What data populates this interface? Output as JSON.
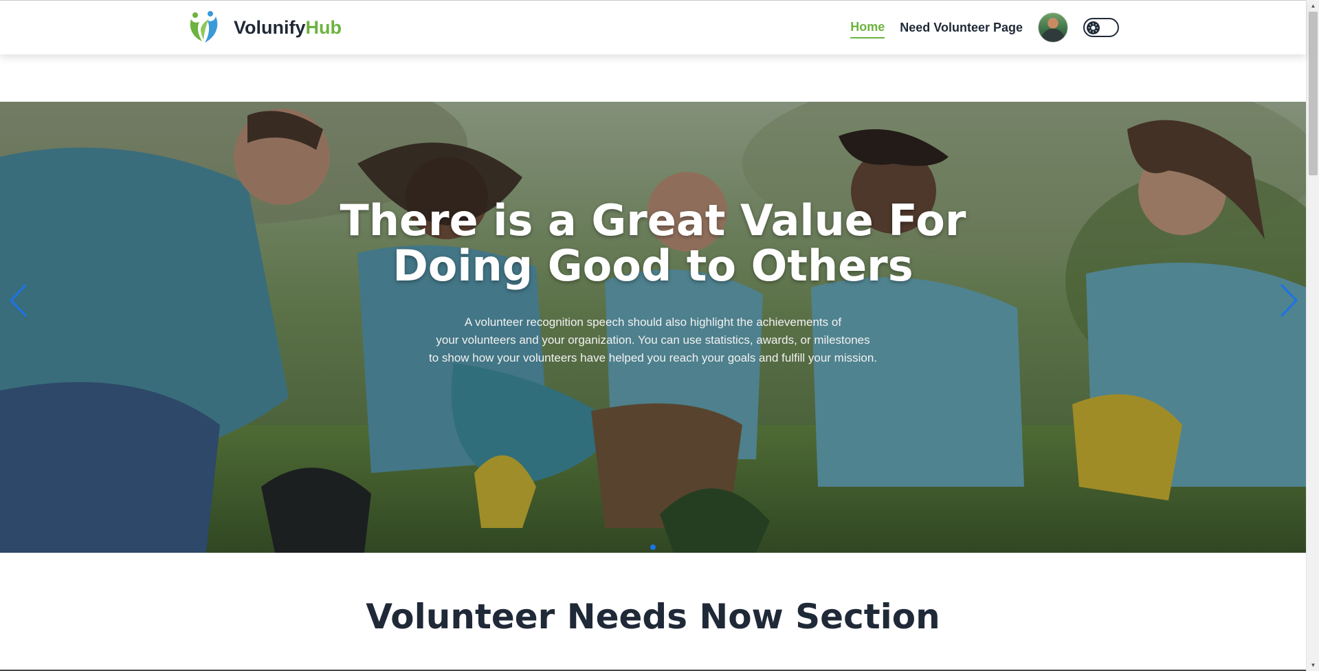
{
  "brand": {
    "name_main": "Volunify",
    "name_accent": "Hub",
    "logo_icon": "leaf-people-logo-icon",
    "accent_color": "#6cb33f"
  },
  "nav": {
    "items": [
      {
        "label": "Home",
        "active": true
      },
      {
        "label": "Need Volunteer Page",
        "active": false
      }
    ],
    "avatar_icon": "user-avatar",
    "theme_toggle_icon": "sun-icon"
  },
  "hero": {
    "title": "There is a Great Value For Doing Good to Others",
    "description_lines": [
      "A volunteer recognition speech should also highlight the achievements of",
      "your volunteers and your organization. You can use statistics, awards, or milestones",
      "to show how your volunteers have helped you reach your goals and fulfill your mission."
    ],
    "prev_icon": "chevron-left-icon",
    "next_icon": "chevron-right-icon",
    "arrow_color": "#1a73e8",
    "active_slide": 1,
    "slide_count": 1
  },
  "section": {
    "title": "Volunteer Needs Now Section"
  }
}
